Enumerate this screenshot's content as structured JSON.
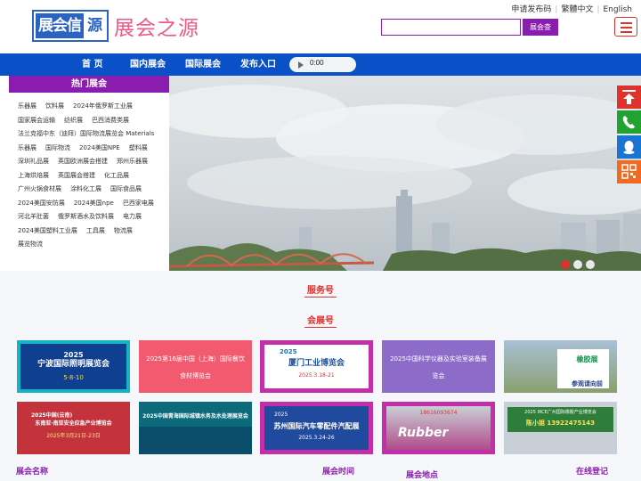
{
  "header": {
    "logo_text": "展会信息",
    "logo_char": "源",
    "slogan": "展会之源",
    "top_links": [
      "申请发布码",
      "繁體中文",
      "English"
    ],
    "search_button": "展会查",
    "search_placeholder": ""
  },
  "nav": {
    "items": [
      "首 页",
      "国内展会",
      "国际展会",
      "发布入口"
    ],
    "audio_time": "0:00"
  },
  "hot": {
    "title": "热门展会",
    "rows": [
      [
        "乐器展",
        "饮料展",
        "2024年俄罗斯工业展"
      ],
      [
        "国家展会运输",
        "纺织展",
        "巴西消费类展"
      ],
      [
        "法兰克福中东（迪拜）国际物流展览会 Materials"
      ],
      [
        "乐器展",
        "国际物流",
        "2024美国NPE",
        "塑料展"
      ],
      [
        "深圳礼品展",
        "英国欧洲展会搭建",
        "郑州乐器展"
      ],
      [
        "上海烘焙展",
        "英国展会搭建",
        "化工品展"
      ],
      [
        "广州火锅食材展",
        "涂料化工展",
        "国际食品展"
      ],
      [
        "2024美国安防展",
        "2024美国npe",
        "巴西家电展"
      ],
      [
        "河北羊肚菌",
        "俄罗斯酒水及饮料展",
        "电力展"
      ],
      [
        "2024美国塑料工业展",
        "工具展",
        "物流展"
      ],
      [
        "展览物流"
      ]
    ]
  },
  "sections": {
    "service": "服务号",
    "exhibition": "会展号"
  },
  "cards_row1": [
    {
      "kind": "image",
      "title": "2025",
      "text": "宁波国际照明展览会",
      "sub": "5·8-10"
    },
    {
      "kind": "text",
      "text": "2025第16届中国（上海）国际餐饮食材博览会"
    },
    {
      "kind": "image",
      "title": "2025",
      "text": "厦门工业博览会",
      "sub": "2025.3.18-21"
    },
    {
      "kind": "text",
      "text": "2025中国科学仪器及实验室装备展览会"
    },
    {
      "kind": "image",
      "title": "",
      "text": "橡胶展",
      "sub": "参观请向前"
    }
  ],
  "cards_row2": [
    {
      "kind": "image",
      "title": "2025中国(云南)",
      "text": "东南亚·南亚安全应急产业博览会",
      "sub": "2025年3月21日-23日"
    },
    {
      "kind": "image",
      "title": "2025中国青海国际城镇水务及水处理展览会",
      "text": "",
      "sub": ""
    },
    {
      "kind": "image",
      "title": "2025",
      "text": "苏州国际汽车零配件汽配展",
      "sub": "2025.3.24-26"
    },
    {
      "kind": "image",
      "title": "",
      "text": "Rubber",
      "sub": "18616093674"
    },
    {
      "kind": "image",
      "title": "2025 IRCE广州国际橡胶产业博览会",
      "text": "陈小姐 13922475143",
      "sub": ""
    }
  ],
  "footer_heads": [
    "展会名称",
    "展会时间",
    "展会地点",
    "在线登记"
  ],
  "colors": {
    "primary_blue": "#0a51c7",
    "purple": "#8a1db0",
    "accent_red": "#e0322c",
    "logo_pink": "#ef5a85"
  },
  "icons": [
    "top-icon",
    "phone-icon",
    "qq-icon",
    "qrcode-icon"
  ]
}
